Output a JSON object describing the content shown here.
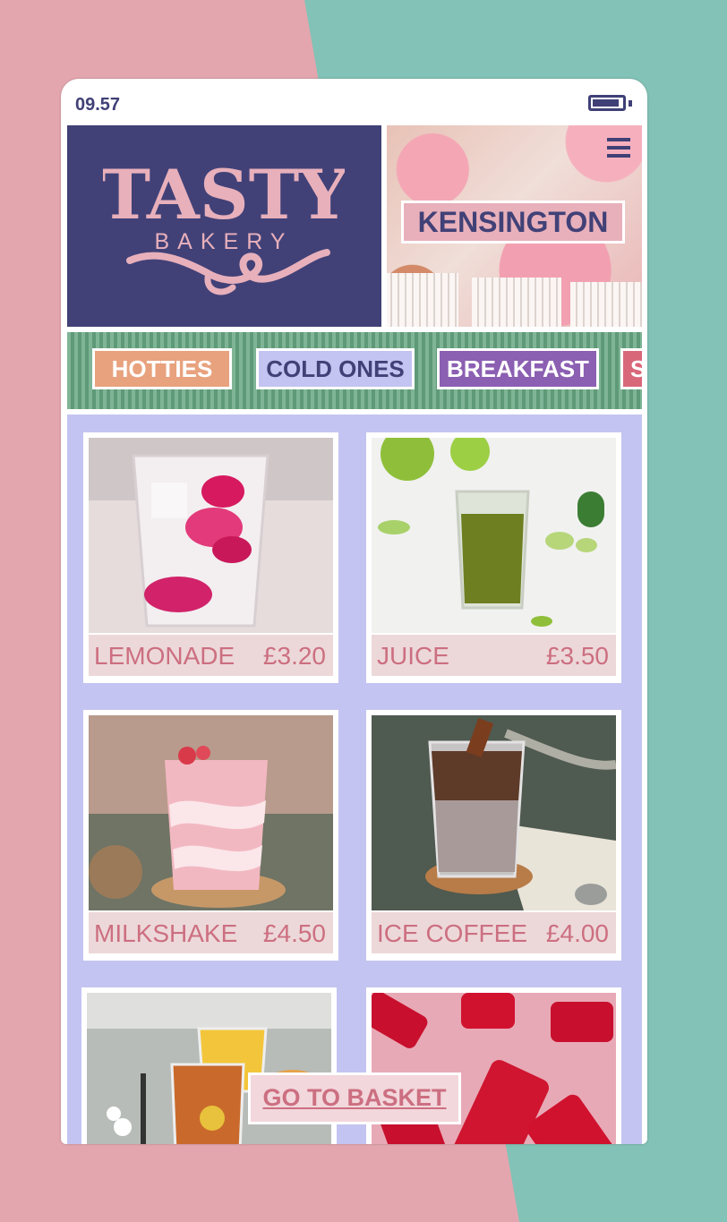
{
  "status": {
    "time": "09.57",
    "battery_level": 0.9
  },
  "brand": {
    "name_line1": "TASTY",
    "name_line2": "BAKERY"
  },
  "header": {
    "location": "KENSINGTON"
  },
  "colors": {
    "navy": "#414177",
    "pink": "#e8b0bb",
    "teal": "#83c2b6",
    "lavender": "#c4c4f2",
    "price_pink": "#cc6f81"
  },
  "tabs": [
    {
      "label": "HOTTIES",
      "bg": "#e8a27e",
      "color": "#ffffff"
    },
    {
      "label": "COLD ONES",
      "bg": "#c4c4f2",
      "color": "#414177"
    },
    {
      "label": "BREAKFAST",
      "bg": "#8b5fb2",
      "color": "#ffffff"
    },
    {
      "label": "S",
      "bg": "#d9677a",
      "color": "#ffffff"
    }
  ],
  "products": [
    {
      "name": "LEMONADE",
      "price": "£3.20"
    },
    {
      "name": "JUICE",
      "price": "£3.50"
    },
    {
      "name": "MILKSHAKE",
      "price": "£4.50"
    },
    {
      "name": "ICE COFFEE",
      "price": "£4.00"
    }
  ],
  "basket": {
    "label": "GO TO BASKET"
  }
}
